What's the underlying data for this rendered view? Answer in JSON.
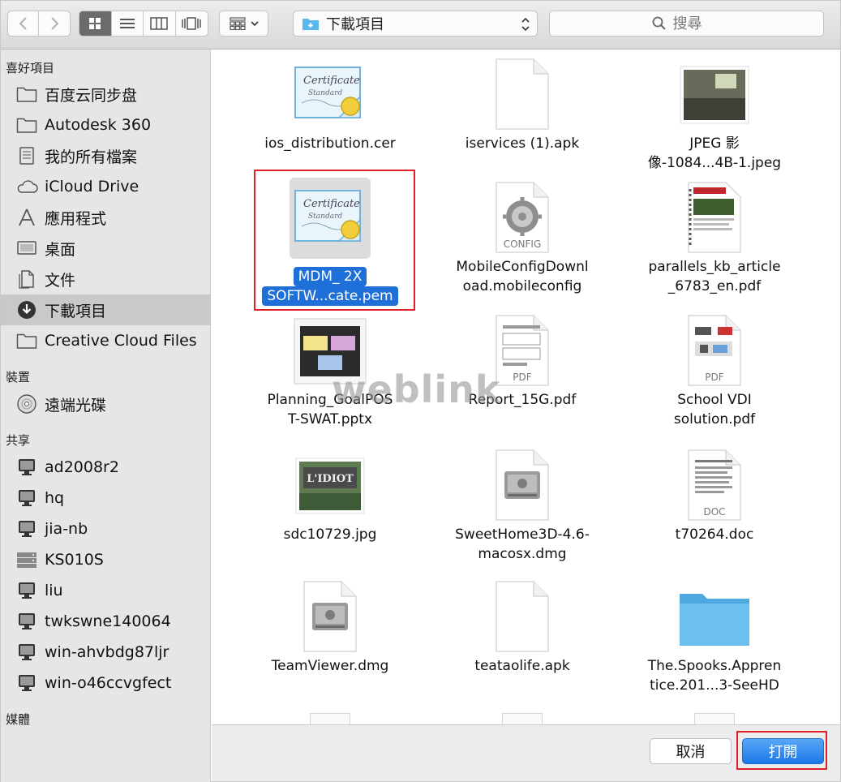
{
  "toolbar": {
    "path_label": "下載項目",
    "search_placeholder": "搜尋"
  },
  "sidebar": {
    "favorites_title": "喜好項目",
    "favorites": [
      {
        "label": "百度云同步盘",
        "icon": "folder-icon"
      },
      {
        "label": "Autodesk 360",
        "icon": "folder-icon"
      },
      {
        "label": "我的所有檔案",
        "icon": "all-files-icon"
      },
      {
        "label": "iCloud Drive",
        "icon": "cloud-icon"
      },
      {
        "label": "應用程式",
        "icon": "applications-icon"
      },
      {
        "label": "桌面",
        "icon": "desktop-icon"
      },
      {
        "label": "文件",
        "icon": "documents-icon"
      },
      {
        "label": "下載項目",
        "icon": "downloads-icon",
        "selected": true
      },
      {
        "label": "Creative Cloud Files",
        "icon": "folder-icon"
      }
    ],
    "devices_title": "裝置",
    "devices": [
      {
        "label": "遠端光碟",
        "icon": "disc-icon"
      }
    ],
    "shared_title": "共享",
    "shared": [
      {
        "label": "ad2008r2",
        "icon": "monitor-icon"
      },
      {
        "label": "hq",
        "icon": "monitor-icon"
      },
      {
        "label": "jia-nb",
        "icon": "monitor-icon"
      },
      {
        "label": "KS010S",
        "icon": "server-icon"
      },
      {
        "label": "liu",
        "icon": "monitor-icon"
      },
      {
        "label": "twkswne140064",
        "icon": "monitor-icon"
      },
      {
        "label": "win-ahvbdg87ljr",
        "icon": "monitor-icon"
      },
      {
        "label": "win-o46ccvgfect",
        "icon": "monitor-icon"
      }
    ],
    "media_title": "媒體"
  },
  "files": [
    {
      "line1": "ios_distribution.cer",
      "line2": "",
      "icon": "certificate-icon"
    },
    {
      "line1": "iservices (1).apk",
      "line2": "",
      "icon": "blank-file-icon"
    },
    {
      "line1": "JPEG 影",
      "line2": "像-1084...4B-1.jpeg",
      "icon": "photo-icon"
    },
    {
      "line1": "MDM_ 2X",
      "line2": "SOFTW...cate.pem",
      "icon": "certificate-icon",
      "selected": true
    },
    {
      "line1": "MobileConfigDownl",
      "line2": "oad.mobileconfig",
      "icon": "config-gear-icon",
      "badge": "CONFIG"
    },
    {
      "line1": "parallels_kb_article",
      "line2": "_6783_en.pdf",
      "icon": "pdf-doc-icon"
    },
    {
      "line1": "Planning_GoalPOS",
      "line2": "T-SWAT.pptx",
      "icon": "slide-icon"
    },
    {
      "line1": "Report_15G.pdf",
      "line2": "",
      "icon": "pdf-form-icon",
      "badge": "PDF"
    },
    {
      "line1": "School VDI",
      "line2": "solution.pdf",
      "icon": "pdf-diagram-icon",
      "badge": "PDF"
    },
    {
      "line1": "sdc10729.jpg",
      "line2": "",
      "icon": "photo-sign-icon"
    },
    {
      "line1": "SweetHome3D-4.6-",
      "line2": "macosx.dmg",
      "icon": "disk-image-icon"
    },
    {
      "line1": "t70264.doc",
      "line2": "",
      "icon": "doc-file-icon",
      "badge": "DOC"
    },
    {
      "line1": "TeamViewer.dmg",
      "line2": "",
      "icon": "disk-image-icon"
    },
    {
      "line1": "teataolife.apk",
      "line2": "",
      "icon": "blank-file-icon"
    },
    {
      "line1": "The.Spooks.Appren",
      "line2": "tice.201...3-SeeHD",
      "icon": "folder-blue-icon"
    }
  ],
  "watermark": "weblink",
  "buttons": {
    "cancel": "取消",
    "open": "打開"
  },
  "colors": {
    "selection": "#1f6fd8",
    "highlight_box": "#e0212b",
    "primary_button": "#1b78e6",
    "folder_blue": "#5bb8ee"
  }
}
